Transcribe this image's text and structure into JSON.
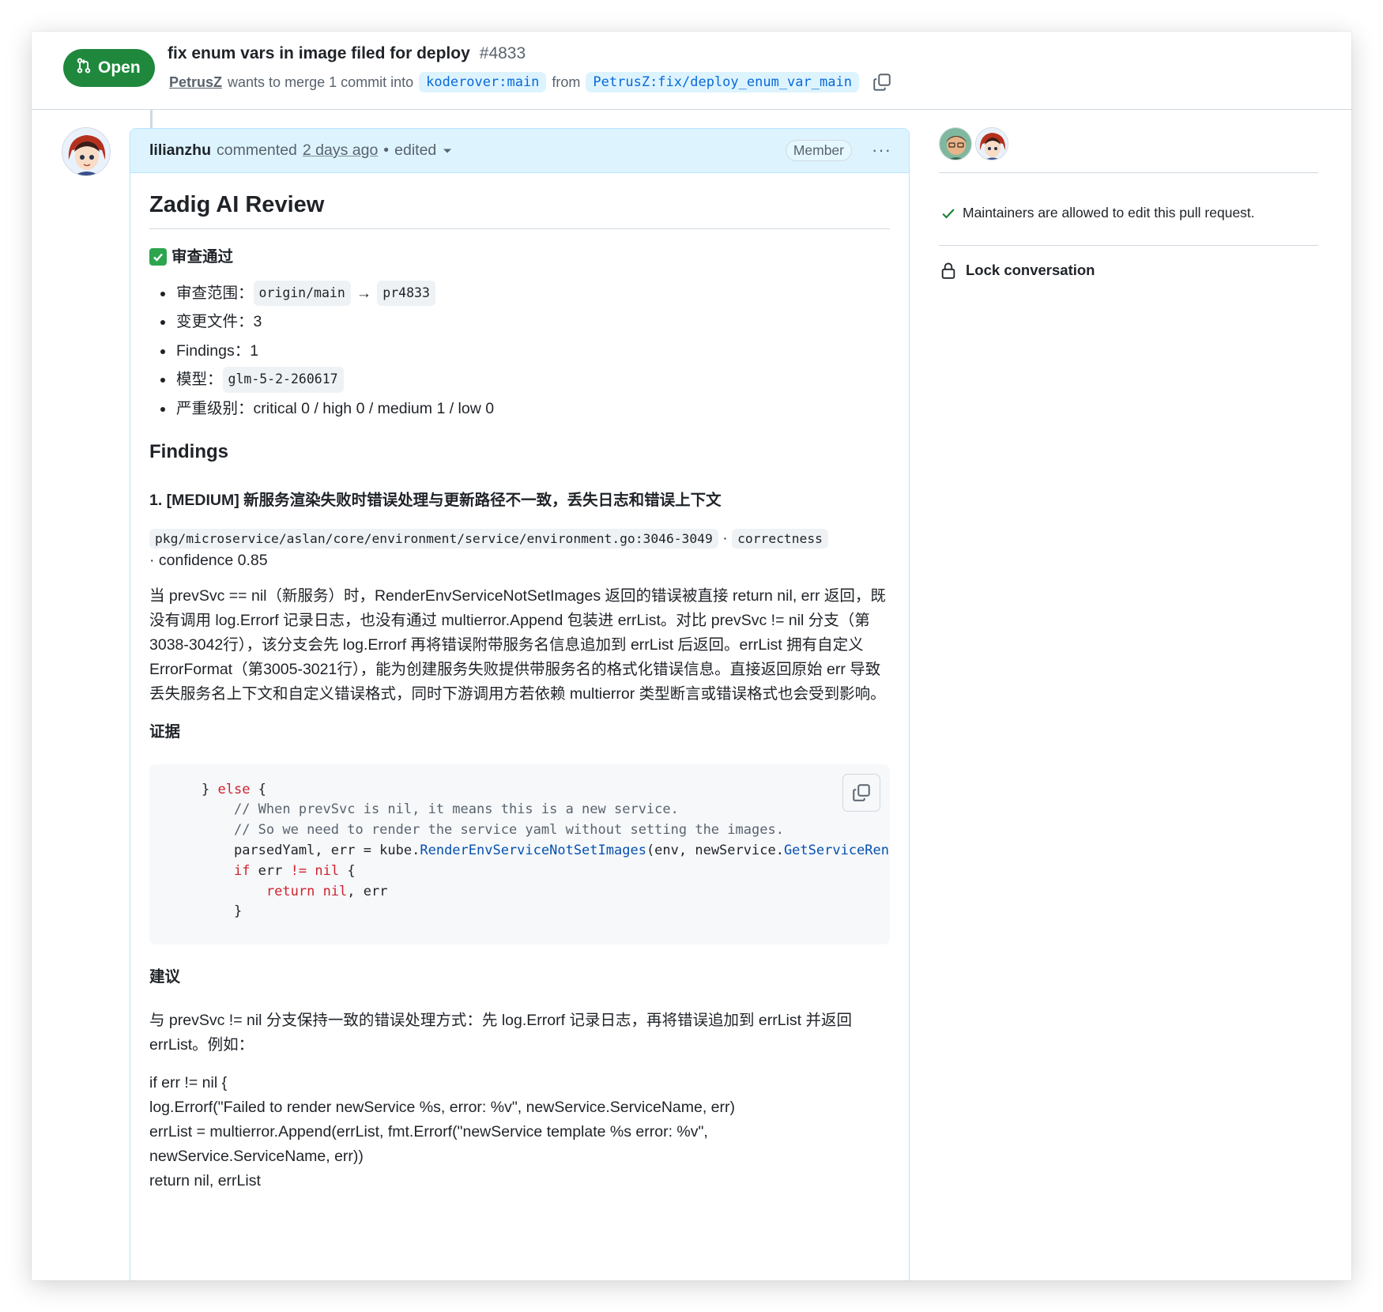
{
  "header": {
    "state": "Open",
    "title": "fix enum vars in image filed for deploy",
    "number": "#4833",
    "author": "PetrusZ",
    "merge_text": "wants to merge 1 commit into",
    "base_branch": "koderover:main",
    "from_text": "from",
    "head_branch": "PetrusZ:fix/deploy_enum_var_main"
  },
  "comment": {
    "author": "lilianzhu",
    "action": "commented",
    "time": "2 days ago",
    "sep": "•",
    "edited": "edited",
    "role": "Member",
    "more": "···",
    "body": {
      "title": "Zadig AI Review",
      "status": "审查通过",
      "meta": [
        {
          "label": "审查范围：",
          "code1": "origin/main",
          "arrow": "→",
          "code2": "pr4833"
        },
        {
          "label": "变更文件：",
          "value": "3"
        },
        {
          "label": "Findings：",
          "value": "1"
        },
        {
          "label": "模型：",
          "code1": "glm-5-2-260617"
        },
        {
          "label": "严重级别：",
          "value": "critical 0 / high 0 / medium 1 / low 0"
        }
      ],
      "findings_heading": "Findings",
      "finding_title": "1. [MEDIUM] 新服务渲染失败时错误处理与更新路径不一致，丢失日志和错误上下文",
      "location": "pkg/microservice/aslan/core/environment/service/environment.go:3046-3049",
      "dot": "·",
      "category": "correctness",
      "confidence": "· confidence 0.85",
      "description": "当 prevSvc == nil（新服务）时，RenderEnvServiceNotSetImages 返回的错误被直接 return nil, err 返回，既没有调用 log.Errorf 记录日志，也没有通过 multierror.Append 包装进 errList。对比 prevSvc != nil 分支（第3038-3042行），该分支会先 log.Errorf 再将错误附带服务名信息追加到 errList 后返回。errList 拥有自定义 ErrorFormat（第3005-3021行），能为创建服务失败提供带服务名的格式化错误信息。直接返回原始 err 导致丢失服务名上下文和自定义错误格式，同时下游调用方若依赖 multierror 类型断言或错误格式也会受到影响。",
      "evidence_heading": "证据",
      "code": {
        "l1_a": "} ",
        "l1_kw": "else",
        "l1_b": " {",
        "l2": "// When prevSvc is nil, it means this is a new service.",
        "l3": "// So we need to render the service yaml without setting the images.",
        "l4_a": "parsedYaml, err = kube.",
        "l4_fn": "RenderEnvServiceNotSetImages",
        "l4_b": "(env, newService.",
        "l4_fn2": "GetServiceRender()",
        "l5_kw": "if",
        "l5_a": " err ",
        "l5_op": "!=",
        "l5_kw2": "nil",
        "l5_b": " {",
        "l6_kw": "return",
        "l6_kw2": "nil",
        "l6_b": ", err",
        "l7": "}"
      },
      "suggestion_heading": "建议",
      "suggestion": "与 prevSvc != nil 分支保持一致的错误处理方式：先 log.Errorf 记录日志，再将错误追加到 errList 并返回 errList。例如：",
      "plain_code": [
        "if err != nil {",
        "log.Errorf(\"Failed to render newService %s, error: %v\", newService.ServiceName, err)",
        "errList = multierror.Append(errList, fmt.Errorf(\"newService template %s error: %v\",",
        "newService.ServiceName, err))",
        "return nil, errList"
      ]
    }
  },
  "sidebar": {
    "maintainers": "Maintainers are allowed to edit this pull request.",
    "lock": "Lock conversation"
  },
  "colors": {
    "open_green": "#1f883d",
    "link_blue": "#0969da",
    "header_bg": "#ddf4ff"
  }
}
